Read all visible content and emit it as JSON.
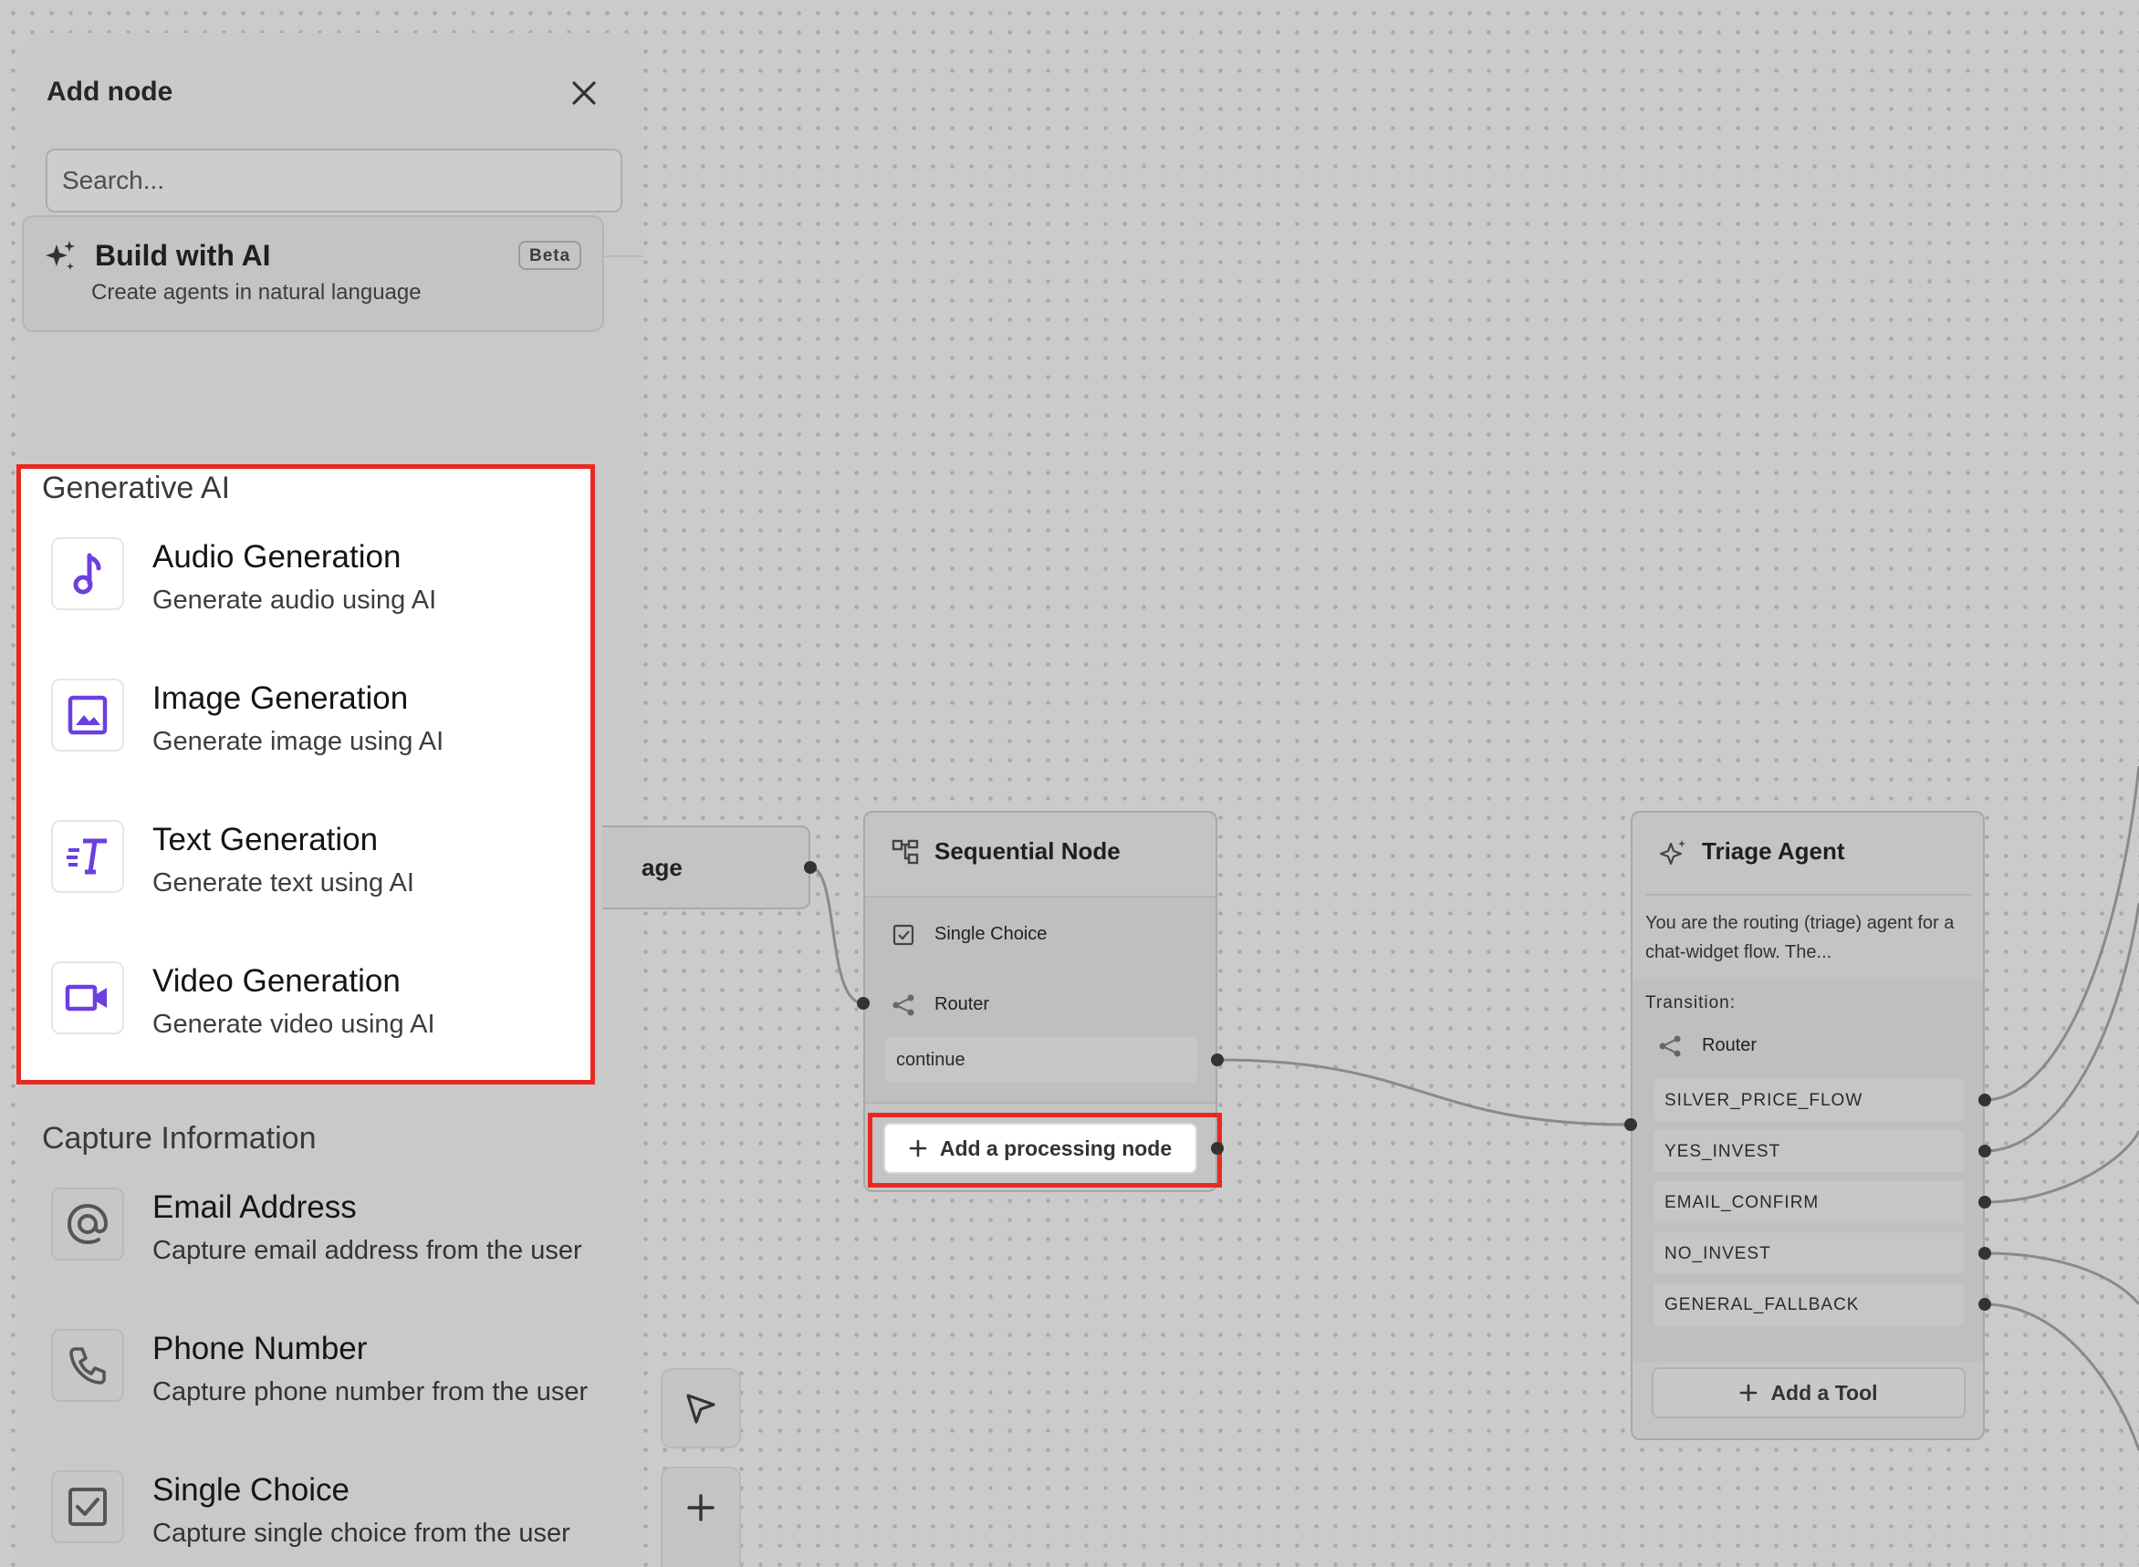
{
  "sidebar": {
    "title": "Add node",
    "search_placeholder": "Search...",
    "build_ai": {
      "title": "Build with AI",
      "description": "Create agents in natural language",
      "badge": "Beta"
    },
    "sections": [
      {
        "title": "Generative AI",
        "items": [
          {
            "name": "Audio Generation",
            "description": "Generate audio using AI",
            "icon": "music-note-icon"
          },
          {
            "name": "Image Generation",
            "description": "Generate image using AI",
            "icon": "image-icon"
          },
          {
            "name": "Text Generation",
            "description": "Generate text using AI",
            "icon": "text-generation-icon"
          },
          {
            "name": "Video Generation",
            "description": "Generate video using AI",
            "icon": "video-camera-icon"
          }
        ]
      },
      {
        "title": "Capture Information",
        "items": [
          {
            "name": "Email Address",
            "description": "Capture email address from the user",
            "icon": "at-sign-icon"
          },
          {
            "name": "Phone Number",
            "description": "Capture phone number from the user",
            "icon": "phone-icon"
          },
          {
            "name": "Single Choice",
            "description": "Capture single choice from the user",
            "icon": "checkbox-icon"
          }
        ]
      }
    ]
  },
  "canvas": {
    "prev_node_label": "age",
    "sequential_node": {
      "title": "Sequential Node",
      "steps": [
        {
          "label": "Single Choice",
          "icon": "checkbox-icon"
        },
        {
          "label": "Router",
          "icon": "share-icon"
        }
      ],
      "output": "continue",
      "add_button": "Add a processing node"
    },
    "triage_agent": {
      "title": "Triage Agent",
      "description": "You are the routing (triage) agent for a chat-widget flow. The...",
      "transition_label": "Transition:",
      "router_label": "Router",
      "routes": [
        "SILVER_PRICE_FLOW",
        "YES_INVEST",
        "EMAIL_CONFIRM",
        "NO_INVEST",
        "GENERAL_FALLBACK"
      ],
      "add_tool": "Add a Tool"
    }
  },
  "colors": {
    "highlight": "#e8291f",
    "accent_icon": "#6b3fe0",
    "canvas_bg": "#cbcbcb"
  }
}
